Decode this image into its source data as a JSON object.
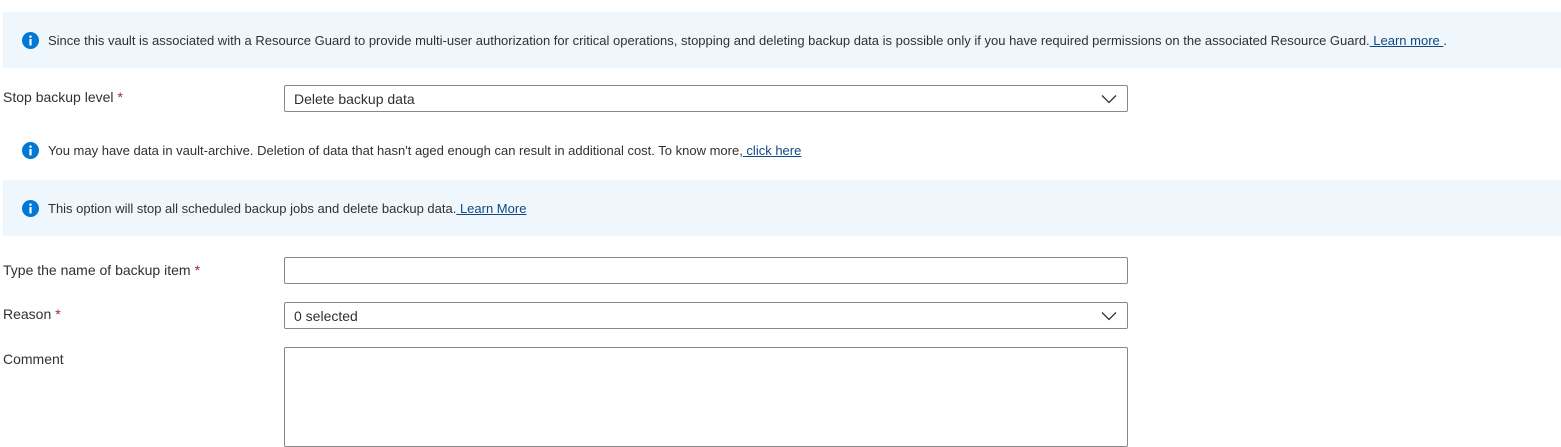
{
  "banners": {
    "resource_guard": {
      "text": "Since this vault is associated with a Resource Guard to provide multi-user authorization for critical operations, stopping and deleting backup data is possible only if you have required permissions on the associated Resource Guard.",
      "link": " Learn more ",
      "suffix": "."
    },
    "vault_archive": {
      "text": "You may have data in vault-archive. Deletion of data that hasn't aged enough can result in additional cost. To know more,",
      "link": " click here "
    },
    "stop_option": {
      "text": "This option will stop all scheduled backup jobs and delete backup data.",
      "link": " Learn More "
    }
  },
  "form": {
    "stop_level": {
      "label": "Stop backup level",
      "required_mark": "*",
      "value": "Delete backup data"
    },
    "backup_item_name": {
      "label": "Type the name of backup item",
      "required_mark": "*",
      "value": ""
    },
    "reason": {
      "label": "Reason",
      "required_mark": "*",
      "value": "0 selected"
    },
    "comment": {
      "label": "Comment",
      "value": ""
    }
  },
  "icons": {
    "info": "info-icon",
    "dropdown": "chevron-down-icon"
  },
  "colors": {
    "info_icon": "#0078d4",
    "banner_background": "#eff6fc",
    "link": "#0f4a85",
    "required": "#a4262c",
    "field_border": "#8a8886",
    "text": "#323130"
  }
}
